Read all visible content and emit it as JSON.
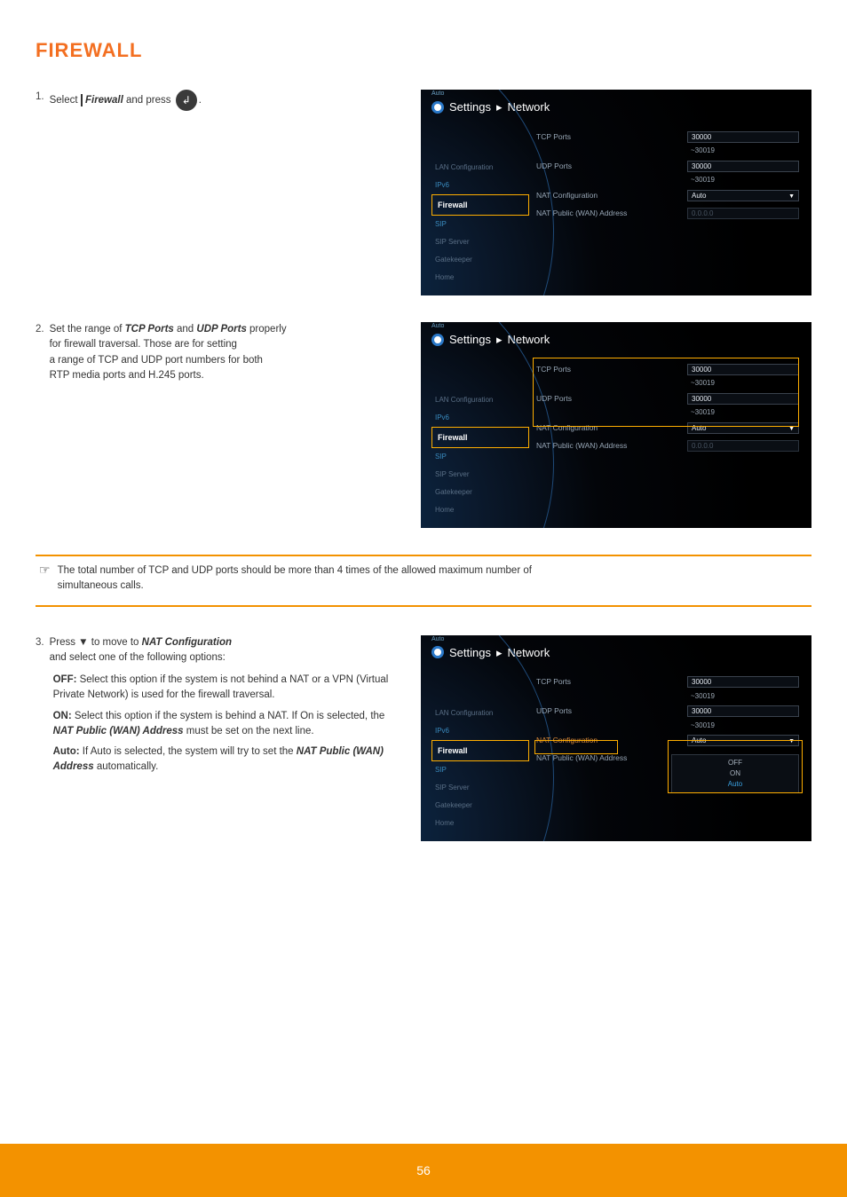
{
  "page_number": "56",
  "heading": "FIREWALL",
  "screens": {
    "breadcrumb_settings": "Settings",
    "breadcrumb_sep": "▸",
    "breadcrumb_network": "Network",
    "auto_label": "Auto",
    "menu": {
      "lan": "LAN Configuration",
      "ipv6": "IPv6",
      "firewall": "Firewall",
      "sip": "SIP",
      "sip_server": "SIP Server",
      "gatekeeper": "Gatekeeper",
      "home": "Home"
    },
    "fields": {
      "tcp_ports": "TCP Ports",
      "udp_ports": "UDP Ports",
      "nat_config": "NAT Configuration",
      "nat_pub": "NAT Public (WAN) Address",
      "val_30000": "30000",
      "range_30019": "~30019",
      "val_auto": "Auto",
      "val_ip": "0.0.0.0"
    },
    "dropdown": {
      "off": "OFF",
      "on": "ON",
      "auto": "Auto"
    }
  },
  "step1_label": "Firewall",
  "step1_num": "1.",
  "step1_pre": "Select",
  "step1_post": "and press",
  "step1_final": ".",
  "step2": {
    "num": "2.",
    "l1a": "Set the range of ",
    "l1b": "TCP Ports",
    "l1c": " and ",
    "l1d": "UDP Ports",
    "l1e": " properly",
    "l2": "for firewall traversal. Those are for setting",
    "l3": "a range of TCP and UDP port numbers for both",
    "l4": "RTP media ports and H.245 ports."
  },
  "note": {
    "l1": "The total number of TCP and UDP ports should be more than 4 times of the allowed maximum number of",
    "l2": "simultaneous calls."
  },
  "step3": {
    "num": "3.",
    "l1": "Press ▼ to move to ",
    "l1b": "NAT Configuration",
    "l2": "and select one of the following options:",
    "off_h": "OFF:",
    "off_b": " Select this option if the system is not behind a NAT or a VPN (Virtual Private Network) is used for the firewall traversal.",
    "on_h": "ON:",
    "on_b_a": " Select this option if the system is behind a NAT. If On is selected, the ",
    "on_b_b": "NAT Public (WAN) Address",
    "on_b_c": " must be set on the next line.",
    "auto_h": "Auto:",
    "auto_b_a": " If Auto is selected, the system will try to set the ",
    "auto_b_b": "NAT Public (WAN) Address",
    "auto_b_c": " automatically."
  }
}
